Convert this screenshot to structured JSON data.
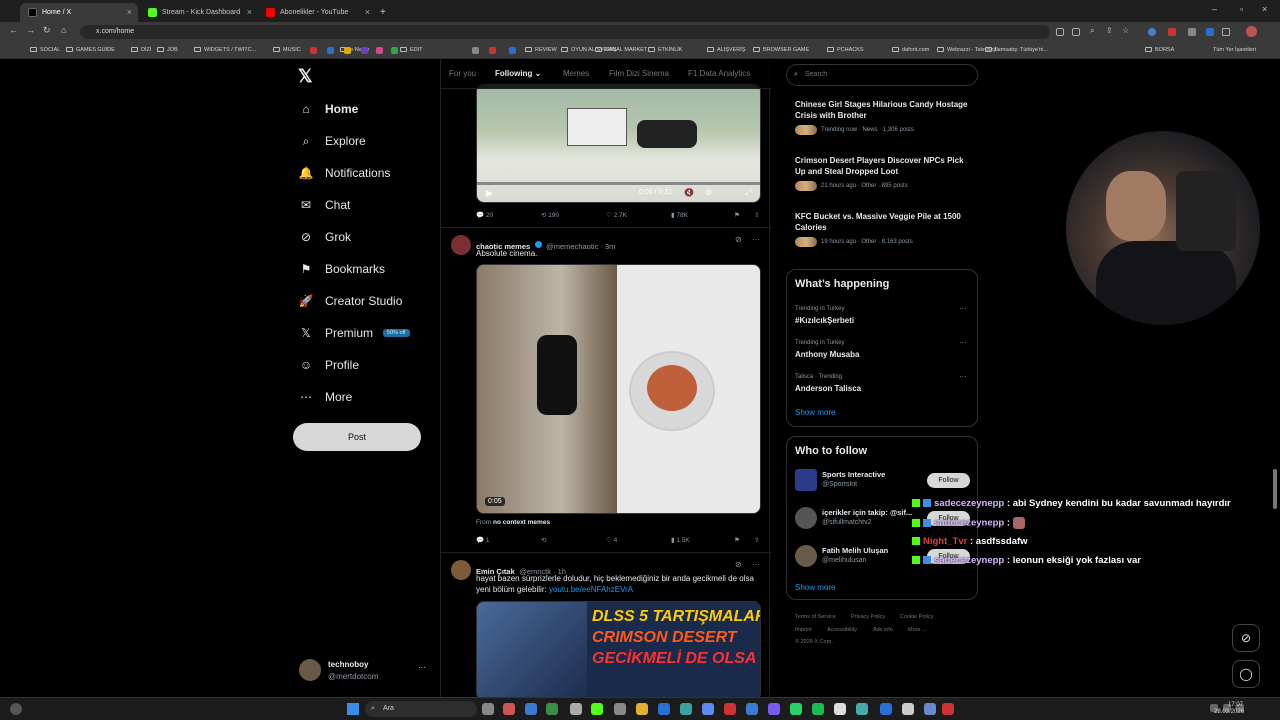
{
  "browser": {
    "tabs": [
      {
        "label": "Home / X",
        "active": true
      },
      {
        "label": "Stream - Kick Dashboard",
        "active": false
      },
      {
        "label": "Abonelikler - YouTube",
        "active": false
      }
    ],
    "new_tab": "+",
    "url": "x.com/home",
    "bookmarks": [
      "SOCIAL",
      "GAMES GUIDE",
      "DİZİ",
      "JOB",
      "WIDGETS / TWITC...",
      "MUSIC",
      "e-Nabız",
      "EDIT",
      "REVIEW",
      "OYUN ALIŞVERİŞ",
      "SANAL MARKET",
      "ETKİNLİK",
      "ALIŞVERİŞ",
      "BROWSER GAME",
      "PCHACKS",
      "dafont.com",
      "Webrazzi - Teknoloji...",
      "İlemsatış: Türkiye'ni...",
      "BORSA"
    ],
    "all_bookmarks": "Tüm Yer İşaretleri"
  },
  "sidebar": {
    "items": [
      {
        "label": "Home",
        "icon": "home-icon"
      },
      {
        "label": "Explore",
        "icon": "search-icon"
      },
      {
        "label": "Notifications",
        "icon": "bell-icon"
      },
      {
        "label": "Chat",
        "icon": "mail-icon"
      },
      {
        "label": "Grok",
        "icon": "grok-icon"
      },
      {
        "label": "Bookmarks",
        "icon": "bookmark-icon"
      },
      {
        "label": "Creator Studio",
        "icon": "rocket-icon"
      },
      {
        "label": "Premium",
        "icon": "x-logo-icon"
      },
      {
        "label": "Profile",
        "icon": "person-icon"
      },
      {
        "label": "More",
        "icon": "more-circle-icon"
      }
    ],
    "premium_badge": "50% off",
    "post_label": "Post",
    "account": {
      "name": "technoboy",
      "handle": "@mertdotcom",
      "menu": "···"
    }
  },
  "feed": {
    "tabs": [
      "For you",
      "Following",
      "Memes",
      "Film Dizi Sinema",
      "F1 Data Analytics"
    ],
    "video1": {
      "time": "0:00 / 0:31",
      "replies": "20",
      "reposts": "190",
      "likes": "2.7K",
      "views": "78K"
    },
    "tweet2": {
      "name": "chaotic memes",
      "handle": "@memechaotic · 3m",
      "text": "Absolute cinema.",
      "duration": "0:05",
      "from_prefix": "From",
      "from_name": "no context memes",
      "replies": "1",
      "reposts": "",
      "likes": "4",
      "views": "1.5K"
    },
    "tweet3": {
      "name": "Emin Çıtak",
      "handle": "@emnctk · 1h",
      "text": "hayat bazen sürprizlerle doludur, hiç beklemediğiniz bir anda gecikmeli de olsa yeni bölüm gelebilir:",
      "link": "youtu.be/eeNFAhzEVrA",
      "thumb_lines": [
        "DLSS 5 TARTIŞMALARI",
        "CRIMSON DESERT",
        "GECİKMELİ DE OLSA"
      ]
    }
  },
  "right": {
    "search_placeholder": "Search",
    "news": [
      {
        "title": "Chinese Girl Stages Hilarious Candy Hostage Crisis with Brother",
        "meta": "Trending now · News · 1,306 posts"
      },
      {
        "title": "Crimson Desert Players Discover NPCs Pick Up and Steal Dropped Loot",
        "meta": "21 hours ago · Other · 895 posts"
      },
      {
        "title": "KFC Bucket vs. Massive Veggie Pile at 1500 Calories",
        "meta": "19 hours ago · Other · 8,163 posts"
      }
    ],
    "happening_title": "What’s happening",
    "trends": [
      {
        "meta": "Trending in Turkey",
        "title": "#KızılcıkŞerbeti"
      },
      {
        "meta": "Trending in Turkey",
        "title": "Anthony Musaba"
      },
      {
        "meta": "Talisca · Trending",
        "title": "Anderson Talisca"
      }
    ],
    "show_more": "Show more",
    "who_title": "Who to follow",
    "follow": [
      {
        "name": "Sports Interactive",
        "handle": "@SportsInt"
      },
      {
        "name": "içerikler için takip: @sif...",
        "handle": "@sifullmatchtv2"
      },
      {
        "name": "Fatih Melih Uluşan",
        "handle": "@melihulusan"
      }
    ],
    "follow_label": "Follow",
    "footer": [
      "Terms of Service",
      "Privacy Policy",
      "Cookie Policy",
      "Imprint",
      "Accessibility",
      "Ads info",
      "More ...",
      "© 2026 X Corp."
    ]
  },
  "overlay": {
    "chat": [
      {
        "user": "sadecezeynepp",
        "msg": "abi Sydney kendini bu kadar savunmadı hayırdır"
      },
      {
        "user": "sadecezeynepp",
        "msg": ""
      },
      {
        "user": "Night_Tvr",
        "msg": "asdfssdafw"
      },
      {
        "user": "sadecezeynepp",
        "msg": "leonun eksiği yok fazlası var"
      }
    ]
  },
  "taskbar": {
    "search": "Ara",
    "time": "17:07",
    "date": "28.03.2026"
  }
}
